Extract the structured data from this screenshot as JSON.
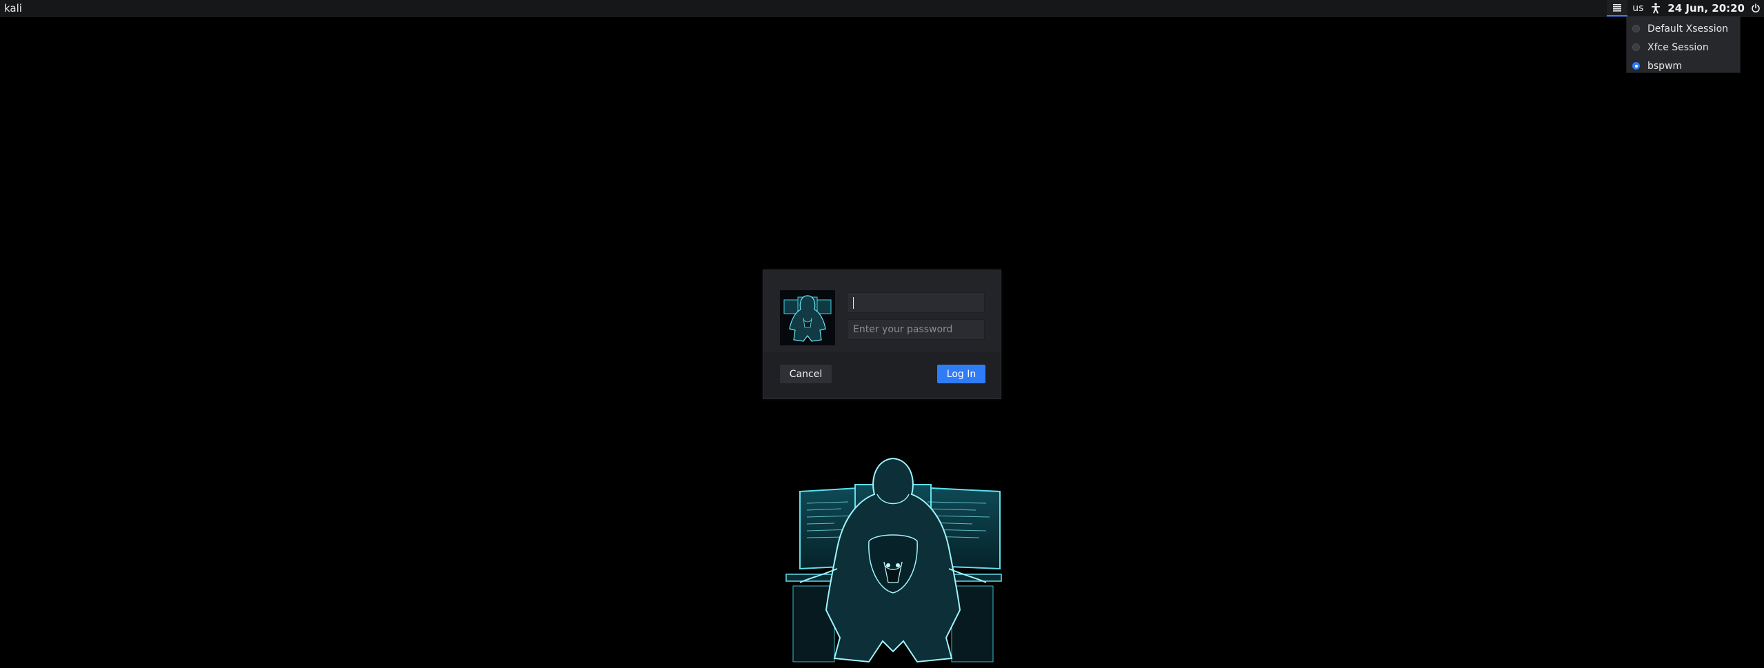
{
  "topbar": {
    "hostname": "kali",
    "session_icon": "list-icon",
    "keyboard_layout": "us",
    "accessibility_icon": "accessibility-icon",
    "clock": "24 Jun, 20:20",
    "power_icon": "power-icon"
  },
  "session_menu": {
    "items": [
      {
        "label": "Default Xsession",
        "selected": false
      },
      {
        "label": "Xfce Session",
        "selected": false
      },
      {
        "label": "bspwm",
        "selected": true
      }
    ]
  },
  "login": {
    "username_value": "",
    "password_placeholder": "Enter your password",
    "cancel_label": "Cancel",
    "login_label": "Log In"
  },
  "colors": {
    "accent": "#2f7cf6",
    "background": "#000000",
    "panel": "#1e2024",
    "figure_glow": "#3fd0e0"
  }
}
